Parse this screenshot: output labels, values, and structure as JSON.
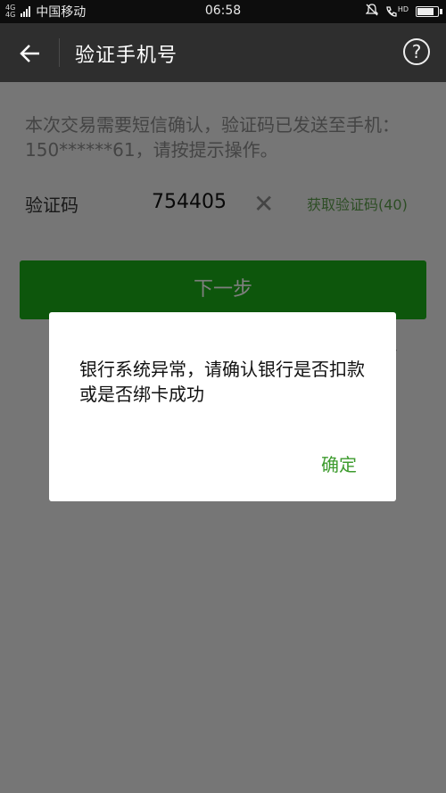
{
  "status_bar": {
    "network_top": "4G",
    "network_bottom": "4G",
    "carrier": "中国移动",
    "time": "06:58",
    "hd": "HD"
  },
  "header": {
    "title": "验证手机号",
    "back_icon": "arrow-left-icon",
    "help_icon": "question-circle-icon",
    "help_glyph": "?"
  },
  "main": {
    "info_text": "本次交易需要短信确认，验证码已发送至手机：150******61，请按提示操作。",
    "code_label": "验证码",
    "code_value": "754405",
    "clear_glyph": "✕",
    "resend_label": "获取验证码(40)",
    "next_label": "下一步",
    "partial_link": "机号"
  },
  "dialog": {
    "message": "银行系统异常，请确认银行是否扣款或是否绑卡成功",
    "ok_label": "确定"
  },
  "colors": {
    "accent_green": "#1aad19",
    "header_bg": "#2e2e2e"
  }
}
